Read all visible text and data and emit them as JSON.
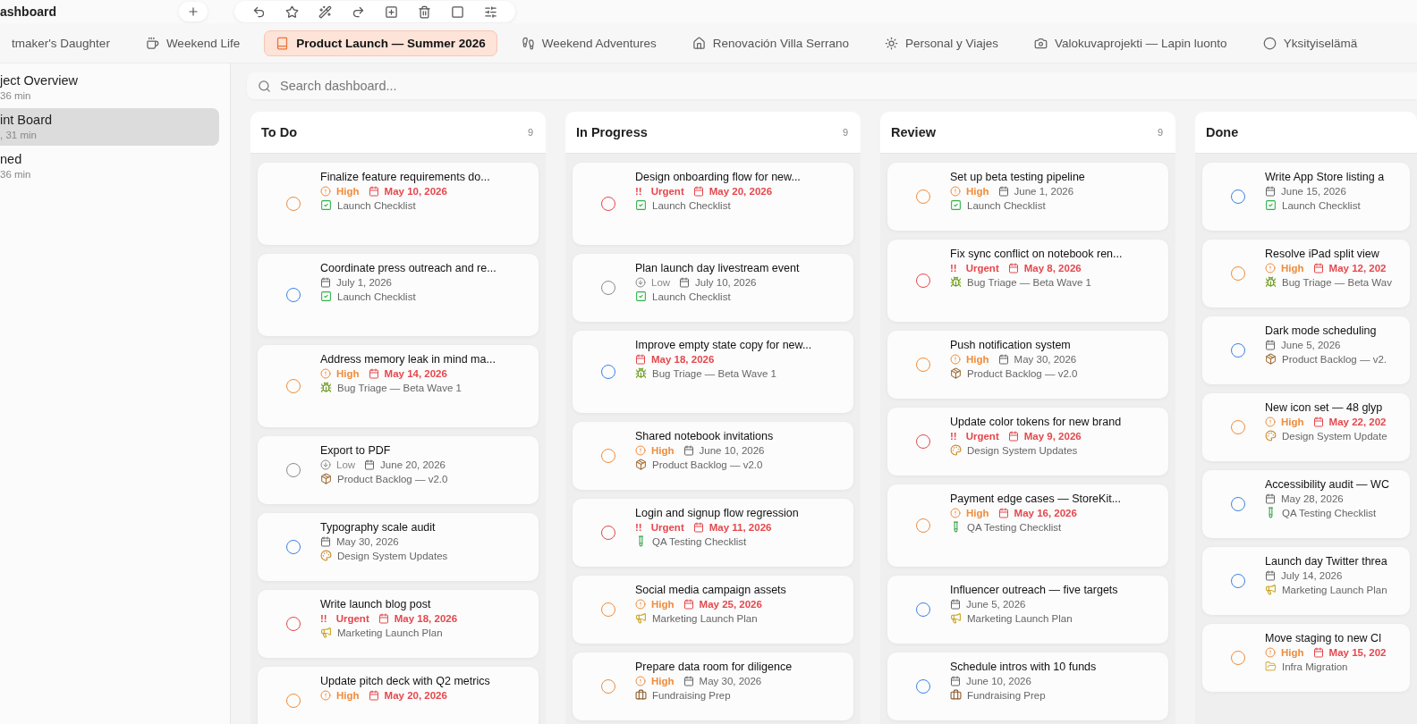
{
  "window": {
    "title": "ashboard"
  },
  "tabs": [
    {
      "label": "tmaker's Daughter",
      "kind": "none",
      "selected": false
    },
    {
      "label": "Weekend Life",
      "kind": "cup",
      "selected": false
    },
    {
      "label": "Product Launch — Summer 2026",
      "kind": "book",
      "selected": true
    },
    {
      "label": "Weekend Adventures",
      "kind": "hiker",
      "selected": false
    },
    {
      "label": "Renovación Villa Serrano",
      "kind": "houses",
      "selected": false
    },
    {
      "label": "Personal y Viajes",
      "kind": "sun",
      "selected": false
    },
    {
      "label": "Valokuvaprojekti — Lapin luonto",
      "kind": "camera",
      "selected": false
    },
    {
      "label": "Yksityiselämä",
      "kind": "dot",
      "selected": false
    }
  ],
  "sidebar": {
    "items": [
      {
        "title": "ject Overview",
        "subtitle": "36 min",
        "selected": false
      },
      {
        "title": "int Board",
        "subtitle": ", 31 min",
        "selected": true
      },
      {
        "title": "ned",
        "subtitle": "36 min",
        "selected": false
      }
    ]
  },
  "search": {
    "placeholder": "Search dashboard..."
  },
  "columns": [
    {
      "title": "To Do",
      "count": "9",
      "cards": [
        {
          "title": "Finalize feature requirements do...",
          "priority": {
            "kind": "high",
            "label": "High"
          },
          "date": "May 10, 2026",
          "overdue": true,
          "project": {
            "kind": "checklist",
            "name": "Launch Checklist"
          }
        },
        {
          "title": "Coordinate press outreach and re...",
          "priority": {
            "kind": "none"
          },
          "date": "July 1, 2026",
          "overdue": false,
          "project": {
            "kind": "checklist",
            "name": "Launch Checklist"
          }
        },
        {
          "title": "Address memory leak in mind ma...",
          "priority": {
            "kind": "high",
            "label": "High"
          },
          "date": "May 14, 2026",
          "overdue": true,
          "project": {
            "kind": "bug",
            "name": "Bug Triage — Beta Wave 1"
          }
        },
        {
          "title": "Export to PDF",
          "priority": {
            "kind": "low",
            "label": "Low"
          },
          "date": "June 20, 2026",
          "overdue": false,
          "project": {
            "kind": "box",
            "name": "Product Backlog — v2.0"
          }
        },
        {
          "title": "Typography scale audit",
          "priority": {
            "kind": "none"
          },
          "date": "May 30, 2026",
          "overdue": false,
          "project": {
            "kind": "palette",
            "name": "Design System Updates"
          }
        },
        {
          "title": "Write launch blog post",
          "priority": {
            "kind": "urgent",
            "mark": "!!",
            "label": "Urgent"
          },
          "date": "May 18, 2026",
          "overdue": true,
          "project": {
            "kind": "megaphone",
            "name": "Marketing Launch Plan"
          }
        },
        {
          "title": "Update pitch deck with Q2 metrics",
          "priority": {
            "kind": "high",
            "label": "High"
          },
          "date": "May 20, 2026",
          "overdue": true
        }
      ]
    },
    {
      "title": "In Progress",
      "count": "9",
      "cards": [
        {
          "title": "Design onboarding flow for new...",
          "priority": {
            "kind": "urgent",
            "mark": "!!",
            "label": "Urgent"
          },
          "date": "May 20, 2026",
          "overdue": true,
          "project": {
            "kind": "checklist",
            "name": "Launch Checklist"
          }
        },
        {
          "title": "Plan launch day livestream event",
          "priority": {
            "kind": "low",
            "label": "Low"
          },
          "date": "July 10, 2026",
          "overdue": false,
          "project": {
            "kind": "checklist",
            "name": "Launch Checklist"
          }
        },
        {
          "title": "Improve empty state copy for new...",
          "priority": {
            "kind": "none"
          },
          "date": "May 18, 2026",
          "overdue": true,
          "project": {
            "kind": "bug",
            "name": "Bug Triage — Beta Wave 1"
          }
        },
        {
          "title": "Shared notebook invitations",
          "priority": {
            "kind": "high",
            "label": "High"
          },
          "date": "June 10, 2026",
          "overdue": false,
          "project": {
            "kind": "box",
            "name": "Product Backlog — v2.0"
          }
        },
        {
          "title": "Login and signup flow regression",
          "priority": {
            "kind": "urgent",
            "mark": "!!",
            "label": "Urgent"
          },
          "date": "May 11, 2026",
          "overdue": true,
          "project": {
            "kind": "tube",
            "name": "QA Testing Checklist"
          }
        },
        {
          "title": "Social media campaign assets",
          "priority": {
            "kind": "high",
            "label": "High"
          },
          "date": "May 25, 2026",
          "overdue": true,
          "project": {
            "kind": "megaphone",
            "name": "Marketing Launch Plan"
          }
        },
        {
          "title": "Prepare data room for diligence",
          "priority": {
            "kind": "high",
            "label": "High"
          },
          "date": "May 30, 2026",
          "overdue": false,
          "project": {
            "kind": "briefcase",
            "name": "Fundraising Prep"
          }
        }
      ]
    },
    {
      "title": "Review",
      "count": "9",
      "cards": [
        {
          "title": "Set up beta testing pipeline",
          "priority": {
            "kind": "high",
            "label": "High"
          },
          "date": "June 1, 2026",
          "overdue": false,
          "project": {
            "kind": "checklist",
            "name": "Launch Checklist"
          }
        },
        {
          "title": "Fix sync conflict on notebook ren...",
          "priority": {
            "kind": "urgent",
            "mark": "!!",
            "label": "Urgent"
          },
          "date": "May 8, 2026",
          "overdue": true,
          "project": {
            "kind": "bug",
            "name": "Bug Triage — Beta Wave 1"
          }
        },
        {
          "title": "Push notification system",
          "priority": {
            "kind": "high",
            "label": "High"
          },
          "date": "May 30, 2026",
          "overdue": false,
          "project": {
            "kind": "box",
            "name": "Product Backlog — v2.0"
          }
        },
        {
          "title": "Update color tokens for new brand",
          "priority": {
            "kind": "urgent",
            "mark": "!!",
            "label": "Urgent"
          },
          "date": "May 9, 2026",
          "overdue": true,
          "project": {
            "kind": "palette",
            "name": "Design System Updates"
          }
        },
        {
          "title": "Payment edge cases — StoreKit...",
          "priority": {
            "kind": "high",
            "label": "High"
          },
          "date": "May 16, 2026",
          "overdue": true,
          "project": {
            "kind": "tube",
            "name": "QA Testing Checklist"
          }
        },
        {
          "title": "Influencer outreach — five targets",
          "priority": {
            "kind": "none"
          },
          "date": "June 5, 2026",
          "overdue": false,
          "project": {
            "kind": "megaphone",
            "name": "Marketing Launch Plan"
          }
        },
        {
          "title": "Schedule intros with 10 funds",
          "priority": {
            "kind": "none"
          },
          "date": "June 10, 2026",
          "overdue": false,
          "project": {
            "kind": "briefcase",
            "name": "Fundraising Prep"
          }
        }
      ]
    },
    {
      "title": "Done",
      "cards": [
        {
          "title": "Write App Store listing a",
          "priority": {
            "kind": "none"
          },
          "date": "June 15, 2026",
          "overdue": false,
          "project": {
            "kind": "checklist",
            "name": "Launch Checklist"
          }
        },
        {
          "title": "Resolve iPad split view",
          "priority": {
            "kind": "high",
            "label": "High"
          },
          "date": "May 12, 202",
          "overdue": true,
          "project": {
            "kind": "bug",
            "name": "Bug Triage — Beta Wav"
          }
        },
        {
          "title": "Dark mode scheduling",
          "priority": {
            "kind": "none"
          },
          "date": "June 5, 2026",
          "overdue": false,
          "project": {
            "kind": "box",
            "name": "Product Backlog — v2."
          }
        },
        {
          "title": "New icon set — 48 glyp",
          "priority": {
            "kind": "high",
            "label": "High"
          },
          "date": "May 22, 202",
          "overdue": true,
          "project": {
            "kind": "palette",
            "name": "Design System Update"
          }
        },
        {
          "title": "Accessibility audit — WC",
          "priority": {
            "kind": "none"
          },
          "date": "May 28, 2026",
          "overdue": false,
          "project": {
            "kind": "tube",
            "name": "QA Testing Checklist"
          }
        },
        {
          "title": "Launch day Twitter threa",
          "priority": {
            "kind": "none"
          },
          "date": "July 14, 2026",
          "overdue": false,
          "project": {
            "kind": "megaphone",
            "name": "Marketing Launch Plan"
          }
        },
        {
          "title": "Move staging to new Cl",
          "priority": {
            "kind": "high",
            "label": "High"
          },
          "date": "May 15, 202",
          "overdue": true,
          "project": {
            "kind": "folder",
            "name": "Infra Migration"
          }
        }
      ]
    }
  ]
}
